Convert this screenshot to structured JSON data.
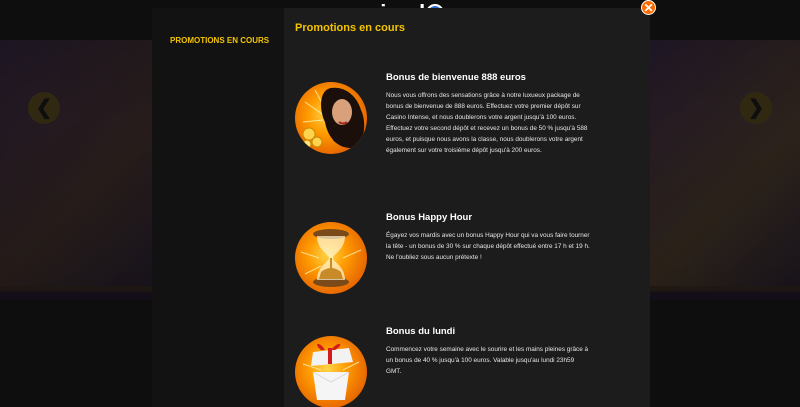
{
  "logo": {
    "text_before": "casinod",
    "text_after": "c"
  },
  "close": {
    "symbol": "✕"
  },
  "background": {
    "arrow_left": "❮",
    "arrow_right": "❯"
  },
  "sidebar": {
    "items": [
      {
        "label": "PROMOTIONS EN COURS"
      }
    ]
  },
  "content": {
    "title": "Promotions en cours",
    "promos": [
      {
        "title": "Bonus de bienvenue 888 euros",
        "description": "Nous vous offrons des sensations grâce à notre luxueux package de bonus de bienvenue de 888 euros. Effectuez votre premier dépôt sur Casino Intense, et nous doublerons votre argent jusqu'à 100 euros. Effectuez votre second dépôt et recevez un bonus de 50 % jusqu'à 588 euros, et puisque nous avons la classe, nous doublerons votre argent également sur votre troisième dépôt jusqu'à 200 euros.",
        "icon": "woman-with-coins-icon"
      },
      {
        "title": "Bonus Happy Hour",
        "description": "Égayez vos mardis avec un bonus Happy Hour qui va vous faire tourner la tête - un bonus de 30 % sur chaque dépôt effectué entre 17 h et 19 h. Ne l'oubliez sous aucun prétexte !",
        "icon": "hourglass-icon"
      },
      {
        "title": "Bonus du lundi",
        "description": "Commencez votre semaine avec le sourire et les mains pleines grâce à un bonus de 40 % jusqu'à 100 euros. Valable jusqu'au lundi 23h59 GMT.",
        "icon": "gift-box-icon"
      }
    ]
  },
  "colors": {
    "accent": "#f4c400",
    "close": "#ff6a00",
    "modal_bg": "#1c1c1c"
  }
}
